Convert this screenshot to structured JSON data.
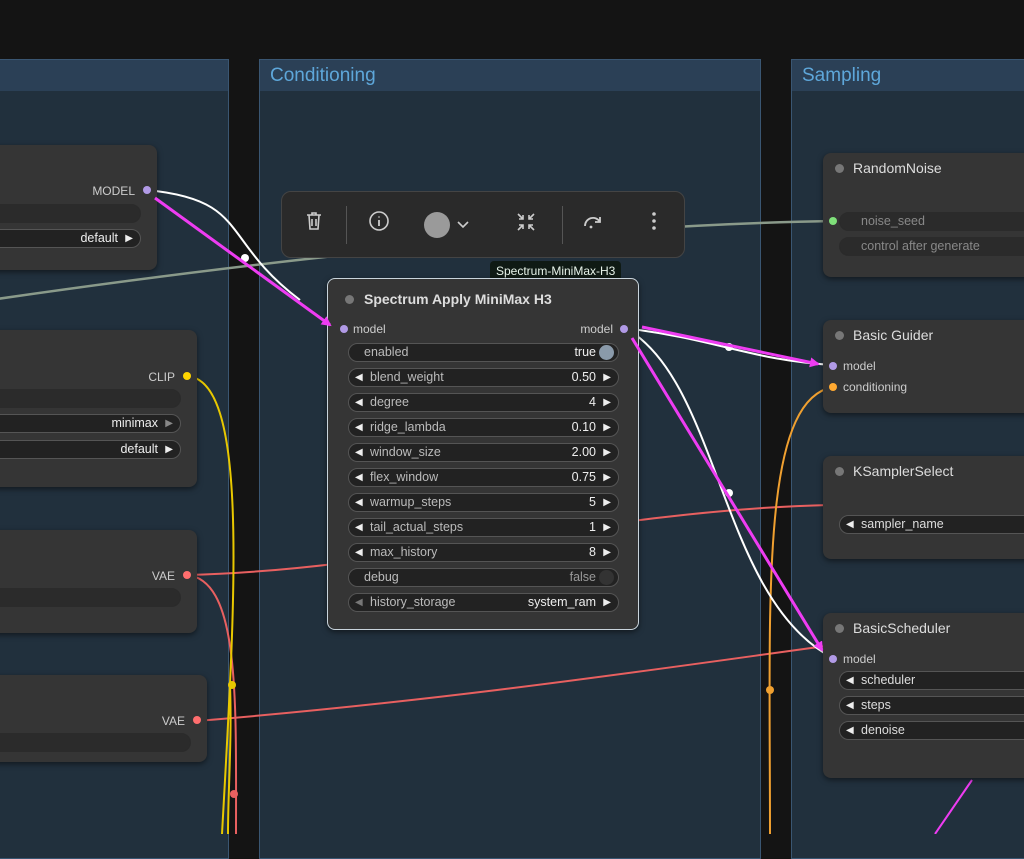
{
  "groups": [
    {
      "name": ""
    },
    {
      "name": "Conditioning"
    },
    {
      "name": "Sampling"
    }
  ],
  "left_nodes": {
    "model_loader": {
      "output_label": "MODEL",
      "select_value": "default"
    },
    "clip_loader": {
      "output_label": "CLIP",
      "select1_value": "minimax",
      "select2_value": "default"
    },
    "vae_loader_1": {
      "output_label": "VAE"
    },
    "vae_loader_2": {
      "output_label": "VAE"
    }
  },
  "toolbar": {
    "delete": "trash-icon",
    "info": "info-icon",
    "color": "color-circle-icon",
    "collapse": "collapse-icon",
    "bypass": "redo-icon",
    "more": "more-vertical-icon"
  },
  "tooltip": "Spectrum-MiniMax-H3",
  "spectrum_node": {
    "title": "Spectrum Apply MiniMax H3",
    "input_label": "model",
    "output_label": "model",
    "enabled": {
      "name": "enabled",
      "value": "true"
    },
    "widgets": [
      {
        "name": "blend_weight",
        "value": "0.50"
      },
      {
        "name": "degree",
        "value": "4"
      },
      {
        "name": "ridge_lambda",
        "value": "0.10"
      },
      {
        "name": "window_size",
        "value": "2.00"
      },
      {
        "name": "flex_window",
        "value": "0.75"
      },
      {
        "name": "warmup_steps",
        "value": "5"
      },
      {
        "name": "tail_actual_steps",
        "value": "1"
      },
      {
        "name": "max_history",
        "value": "8"
      }
    ],
    "debug": {
      "name": "debug",
      "value": "false"
    },
    "history_storage": {
      "name": "history_storage",
      "value": "system_ram"
    }
  },
  "sampling_nodes": {
    "random_noise": {
      "title": "RandomNoise",
      "w1": "noise_seed",
      "w2": "control after generate"
    },
    "basic_guider": {
      "title": "Basic Guider",
      "in1": "model",
      "in2": "conditioning"
    },
    "ksampler_select": {
      "title": "KSamplerSelect",
      "w1": "sampler_name"
    },
    "basic_scheduler": {
      "title": "BasicScheduler",
      "in1": "model",
      "w1": "scheduler",
      "w2": "steps",
      "w3": "denoise"
    }
  },
  "colors": {
    "model": "#b19ae6",
    "clip": "#ffd500",
    "vae": "#ff6e6e",
    "conditioning": "#ffa931",
    "noise": "#7fe07a",
    "arrow": "#ee3cf2"
  }
}
